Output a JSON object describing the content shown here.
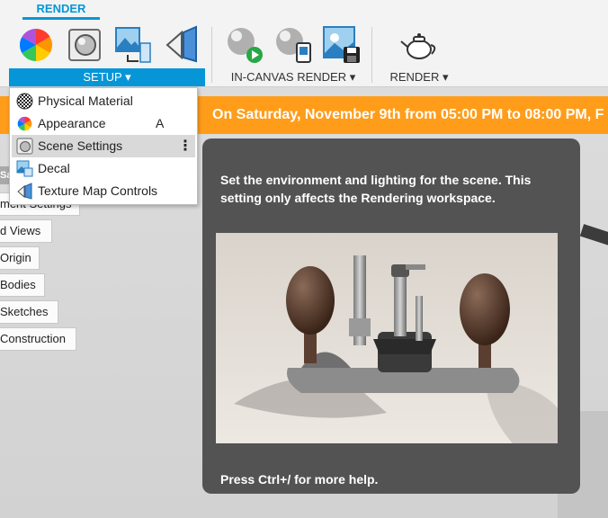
{
  "toolbar": {
    "active_tab": "RENDER",
    "groups": {
      "setup": "SETUP ▾",
      "in_canvas_render": "IN-CANVAS RENDER ▾",
      "render": "RENDER ▾"
    },
    "tools": [
      {
        "icon": "appearance-color-wheel-icon"
      },
      {
        "icon": "scene-settings-icon"
      },
      {
        "icon": "texture-map-icon"
      },
      {
        "icon": "decal-icon"
      },
      {
        "icon": "in-canvas-render-icon"
      },
      {
        "icon": "capture-image-icon"
      },
      {
        "icon": "save-render-icon"
      },
      {
        "icon": "render-teapot-icon"
      }
    ]
  },
  "setup_menu": {
    "items": [
      {
        "label": "Physical Material",
        "icon": "physical-material-icon",
        "shortcut": ""
      },
      {
        "label": "Appearance",
        "icon": "appearance-icon",
        "shortcut": "A"
      },
      {
        "label": "Scene Settings",
        "icon": "scene-settings-icon",
        "shortcut": "",
        "more": "⋮"
      },
      {
        "label": "Decal",
        "icon": "decal-icon",
        "shortcut": ""
      },
      {
        "label": "Texture Map Controls",
        "icon": "texture-map-icon",
        "shortcut": ""
      }
    ]
  },
  "banner": {
    "text": "On Saturday, November 9th from 05:00 PM to 08:00 PM, F"
  },
  "browser": {
    "collapsed_label": "Sa",
    "items": [
      "ment Settings",
      "d Views",
      "Origin",
      "Bodies",
      "Sketches",
      "Construction"
    ]
  },
  "tooltip": {
    "description": "Set the environment and lighting for the scene. This setting only affects the Rendering workspace.",
    "help": "Press Ctrl+/ for more help."
  },
  "colors": {
    "accent_blue": "#0696d7",
    "banner_orange": "#ff9d1a",
    "tooltip_bg": "#535353"
  }
}
